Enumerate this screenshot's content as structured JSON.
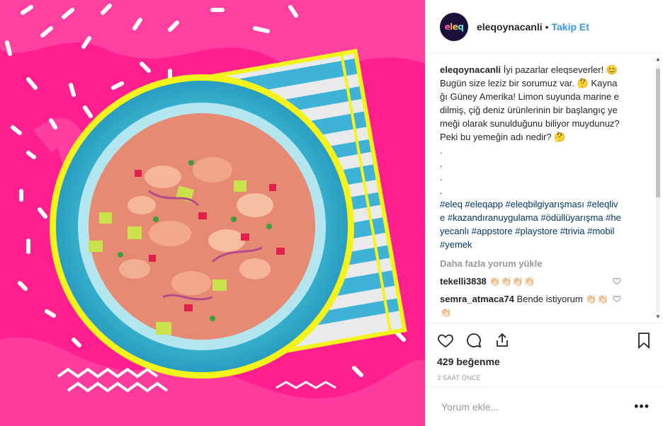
{
  "post": {
    "author": "eleqoynacanli",
    "avatar_text": "eleq",
    "separator": "•",
    "follow_label": "Takip Et",
    "caption_user": "eleqoynacanli",
    "caption_text": "İyi pazarlar eleqseverler! 😊 Bugün size leziz bir sorumuz var. 🤔 Kaynağı Güney Amerika! Limon suyunda marine edilmiş, çiğ deniz ürünlerinin bir başlangıç yemeği olarak sunulduğunu biliyor muydunuz? Peki bu yemeğin adı nedir? 🤔\n.\n.\n.\n.",
    "hashtags": "#eleq #eleqapp #eleqbilgiyarışması #eleqlive #kazandıranuygulama #ödüllüyarışma #heyecanlı #appstore #playstore #trivia #mobil #yemek",
    "load_more": "Daha fazla yorum yükle",
    "comments": [
      {
        "user": "tekelli3838",
        "text": "👏🏻👏🏻👏🏻👏🏻"
      },
      {
        "user": "semra_atmaca74",
        "text": "Bende istiyorum 👏🏻👏🏻👏🏻"
      }
    ],
    "likes": "429 beğenme",
    "time": "3 SAAT ÖNCE",
    "comment_placeholder": "Yorum ekle...",
    "more_options": "•••",
    "icons": [
      "heart-icon",
      "comment-icon",
      "share-icon",
      "bookmark-icon"
    ]
  },
  "colors": {
    "background": "#ff1f8e",
    "plate": "#3fc0d8",
    "accent_yellow": "#f4f41c",
    "link": "#3897f0"
  }
}
